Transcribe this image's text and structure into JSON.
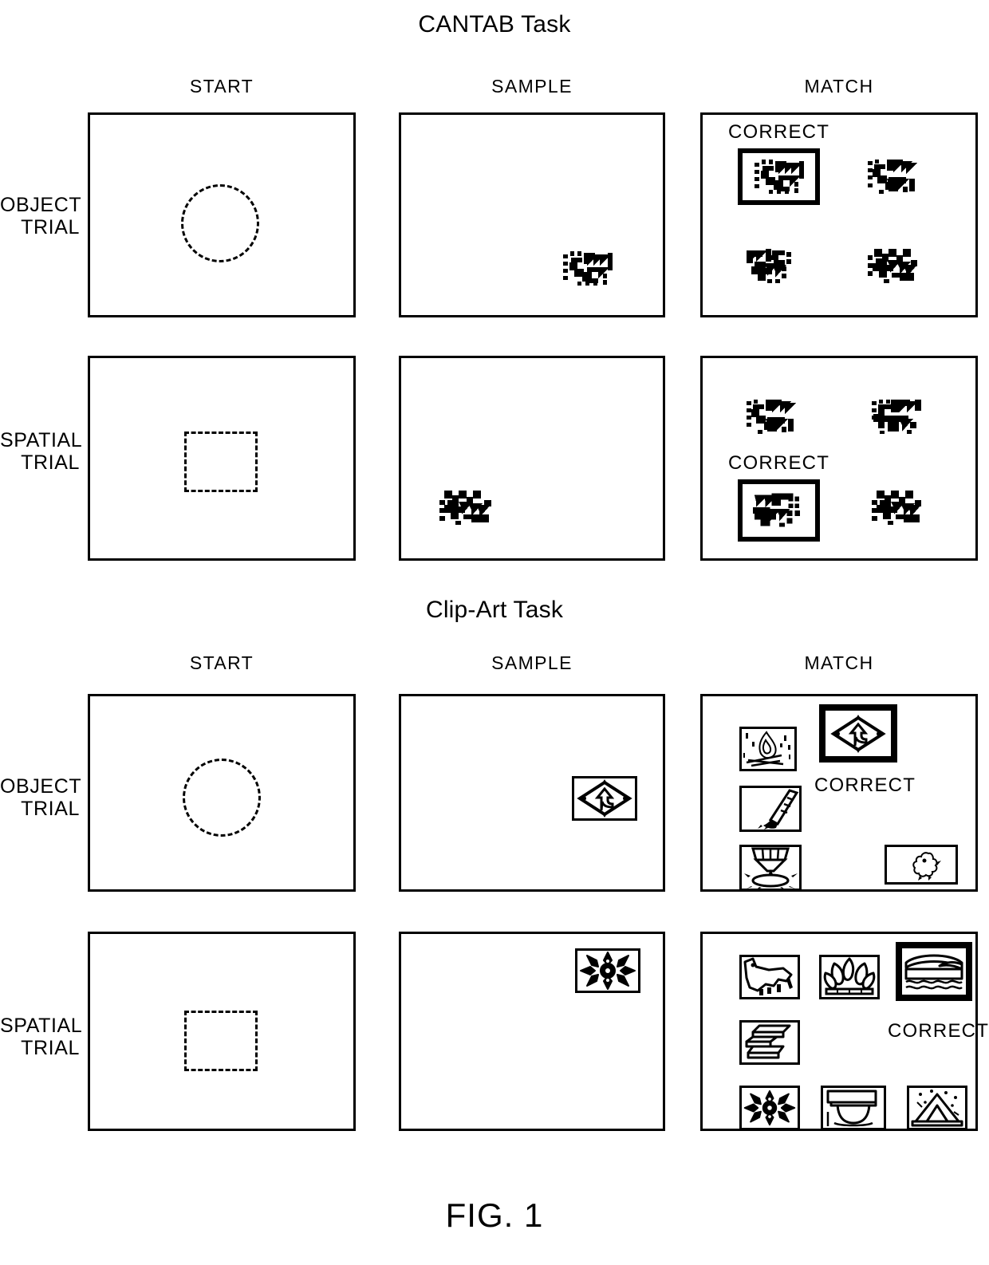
{
  "figure": {
    "label": "FIG. 1"
  },
  "tasks": [
    {
      "id": "cantab",
      "title": "CANTAB Task",
      "columns": [
        "START",
        "SAMPLE",
        "MATCH"
      ],
      "rows": [
        {
          "label_line1": "OBJECT",
          "label_line2": "TRIAL",
          "start": {
            "fixation": "dashed-circle"
          },
          "sample": {
            "stimulus": "abstract-pattern-1",
            "position": "bottom-right"
          },
          "match": {
            "correct_label": "CORRECT",
            "correct_position": "top-left",
            "choices": [
              {
                "stimulus": "abstract-pattern-1",
                "position": "top-left",
                "correct": true
              },
              {
                "stimulus": "abstract-pattern-2",
                "position": "top-right",
                "correct": false
              },
              {
                "stimulus": "abstract-pattern-3",
                "position": "bottom-left",
                "correct": false
              },
              {
                "stimulus": "abstract-pattern-4",
                "position": "bottom-right",
                "correct": false
              }
            ]
          }
        },
        {
          "label_line1": "SPATIAL",
          "label_line2": "TRIAL",
          "start": {
            "fixation": "dash-dot-square"
          },
          "sample": {
            "stimulus": "abstract-pattern-5",
            "position": "bottom-left"
          },
          "match": {
            "correct_label": "CORRECT",
            "correct_position": "bottom-left",
            "choices": [
              {
                "stimulus": "abstract-pattern-6",
                "position": "top-left",
                "correct": false
              },
              {
                "stimulus": "abstract-pattern-7",
                "position": "top-right",
                "correct": false
              },
              {
                "stimulus": "abstract-pattern-5",
                "position": "bottom-left",
                "correct": true
              },
              {
                "stimulus": "abstract-pattern-8",
                "position": "bottom-right",
                "correct": false
              }
            ]
          }
        }
      ]
    },
    {
      "id": "clipart",
      "title": "Clip-Art Task",
      "columns": [
        "START",
        "SAMPLE",
        "MATCH"
      ],
      "rows": [
        {
          "label_line1": "OBJECT",
          "label_line2": "TRIAL",
          "start": {
            "fixation": "dashed-circle"
          },
          "sample": {
            "stimulus": "road-sign",
            "position": "right-middle"
          },
          "match": {
            "correct_label": "CORRECT",
            "correct_position": "top-right",
            "choices": [
              {
                "stimulus": "campfire",
                "correct": false
              },
              {
                "stimulus": "road-sign",
                "correct": true
              },
              {
                "stimulus": "paintbrush",
                "correct": false
              },
              {
                "stimulus": "trophy",
                "correct": false
              },
              {
                "stimulus": "chick",
                "correct": false
              }
            ]
          }
        },
        {
          "label_line1": "SPATIAL",
          "label_line2": "TRIAL",
          "start": {
            "fixation": "dash-dot-square"
          },
          "sample": {
            "stimulus": "snowflake",
            "position": "top-right"
          },
          "match": {
            "correct_label": "CORRECT",
            "correct_position": "top-right",
            "choices": [
              {
                "stimulus": "dog",
                "correct": false
              },
              {
                "stimulus": "crown",
                "correct": false
              },
              {
                "stimulus": "bridge",
                "correct": true
              },
              {
                "stimulus": "stack",
                "correct": false
              },
              {
                "stimulus": "snowflake",
                "correct": false
              },
              {
                "stimulus": "lampshade",
                "correct": false
              },
              {
                "stimulus": "tent",
                "correct": false
              }
            ]
          }
        }
      ]
    }
  ]
}
